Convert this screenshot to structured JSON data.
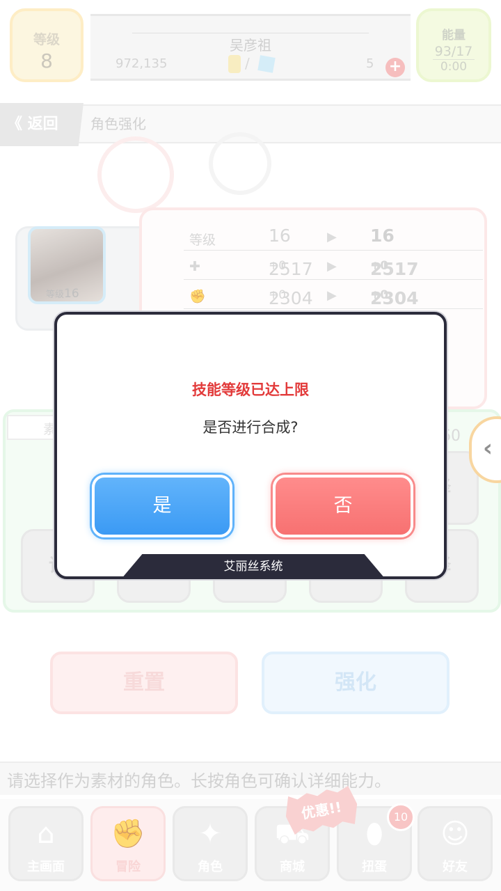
{
  "player": {
    "level_label": "等级",
    "level": "8",
    "name": "吴彦祖",
    "gold": "972,135",
    "gems_separator": "/",
    "item_count": "5",
    "energy_label": "能量",
    "energy": "93/17",
    "energy_timer": "0:00"
  },
  "nav_header": {
    "back_label": "《 返回",
    "page_title": "角色强化"
  },
  "character": {
    "level_prefix": "等级",
    "level": "16",
    "badge": "10"
  },
  "stats": [
    {
      "key": "等级",
      "from": "16",
      "from_bonus": "",
      "to": "16",
      "to_bonus": ""
    },
    {
      "key": "",
      "from": "2517",
      "from_bonus": "+0",
      "to": "2517",
      "to_bonus": "+0"
    },
    {
      "key": "",
      "from": "2304",
      "from_bonus": "+0",
      "to": "2304",
      "to_bonus": "+0"
    }
  ],
  "materials": {
    "title": "素材角色",
    "slot_label_left": "请",
    "slot_label_right": "择",
    "percent": "60"
  },
  "actions": {
    "reset": "重置",
    "enhance": "强化"
  },
  "hint": "请选择作为素材的角色。长按角色可确认详细能力。",
  "bottom_nav": [
    {
      "label": "主画面",
      "icon": "home-icon",
      "glyph": "⌂"
    },
    {
      "label": "冒险",
      "icon": "handshake-icon",
      "glyph": "✊"
    },
    {
      "label": "角色",
      "icon": "rabbit-icon",
      "glyph": "✦"
    },
    {
      "label": "商城",
      "icon": "cart-icon",
      "glyph": "⛟"
    },
    {
      "label": "扭蛋",
      "icon": "egg-icon",
      "glyph": "⬮"
    },
    {
      "label": "好友",
      "icon": "friends-icon",
      "glyph": "☺"
    }
  ],
  "promo_badge": "优惠!!",
  "gacha_count": "10",
  "dialog": {
    "title": "技能等级已达上限",
    "message": "是否进行合成?",
    "yes": "是",
    "no": "否",
    "footer": "艾丽丝系统"
  },
  "colors": {
    "dialog_title": "#e23a3a",
    "yes_button": "#3b9af4",
    "no_button": "#f77171",
    "dialog_frame": "#2b2b3b"
  }
}
